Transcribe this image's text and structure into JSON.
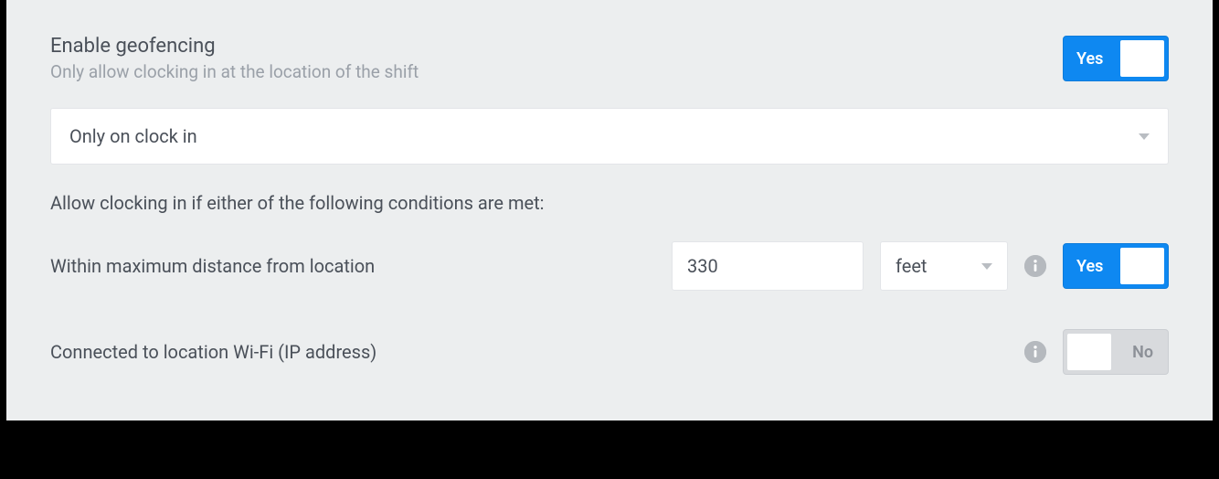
{
  "geofencing": {
    "title": "Enable geofencing",
    "subtitle": "Only allow clocking in at the location of the shift",
    "toggle_on_label": "Yes",
    "toggle_off_label": "No",
    "enabled": true
  },
  "mode_select": {
    "value": "Only on clock in"
  },
  "conditions_label": "Allow clocking in if either of the following conditions are met:",
  "distance": {
    "label": "Within maximum distance from location",
    "value": "330",
    "unit": "feet",
    "enabled": true
  },
  "wifi": {
    "label": "Connected to location Wi-Fi (IP address)",
    "enabled": false
  }
}
